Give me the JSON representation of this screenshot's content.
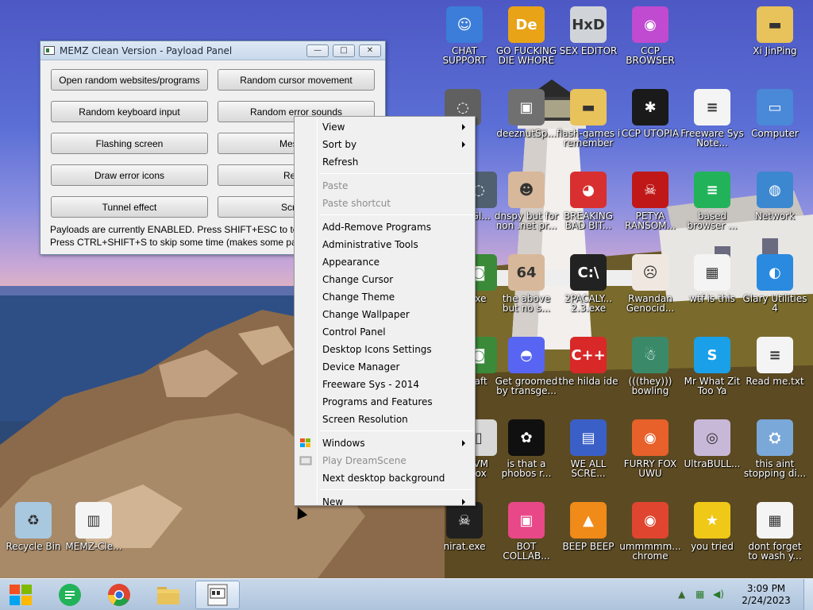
{
  "window": {
    "title": "MEMZ Clean Version - Payload Panel",
    "buttons": [
      "Open random websites/programs",
      "Random cursor movement",
      "Random keyboard input",
      "Random error sounds",
      "Flashing screen",
      "Messag",
      "Draw error icons",
      "Rever",
      "Tunnel effect",
      "Screen"
    ],
    "status_line1": "Payloads are currently ENABLED. Press SHIFT+ESC to toggle all",
    "status_line2": "Press CTRL+SHIFT+S to skip some time (makes some payloads f",
    "minimize_glyph": "—",
    "maximize_glyph": "□",
    "close_glyph": "✕"
  },
  "context_menu": {
    "items": [
      {
        "label": "View",
        "submenu": true,
        "disabled": false
      },
      {
        "label": "Sort by",
        "submenu": true,
        "disabled": false
      },
      {
        "label": "Refresh",
        "submenu": false,
        "disabled": false
      },
      {
        "label": "Paste",
        "submenu": false,
        "disabled": true
      },
      {
        "label": "Paste shortcut",
        "submenu": false,
        "disabled": true
      },
      {
        "label": "Add-Remove Programs",
        "submenu": false,
        "disabled": false
      },
      {
        "label": "Administrative Tools",
        "submenu": false,
        "disabled": false
      },
      {
        "label": "Appearance",
        "submenu": false,
        "disabled": false
      },
      {
        "label": "Change Cursor",
        "submenu": false,
        "disabled": false
      },
      {
        "label": "Change Theme",
        "submenu": false,
        "disabled": false
      },
      {
        "label": "Change Wallpaper",
        "submenu": false,
        "disabled": false
      },
      {
        "label": "Control Panel",
        "submenu": false,
        "disabled": false
      },
      {
        "label": "Desktop Icons Settings",
        "submenu": false,
        "disabled": false
      },
      {
        "label": "Device Manager",
        "submenu": false,
        "disabled": false
      },
      {
        "label": "Freeware Sys - 2014",
        "submenu": false,
        "disabled": false
      },
      {
        "label": "Programs and Features",
        "submenu": false,
        "disabled": false
      },
      {
        "label": "Screen Resolution",
        "submenu": false,
        "disabled": false
      },
      {
        "label": "Windows",
        "submenu": true,
        "disabled": false
      },
      {
        "label": "Play DreamScene",
        "submenu": false,
        "disabled": true
      },
      {
        "label": "Next desktop background",
        "submenu": false,
        "disabled": false
      },
      {
        "label": "New",
        "submenu": true,
        "disabled": false
      }
    ]
  },
  "desktop_icons": [
    {
      "label": "CHAT SUPPORT",
      "icon": "support-person-icon",
      "color": "#3b7dd8",
      "glyph": "☺"
    },
    {
      "label": "GO FUCKING DIE WHORE",
      "icon": "de-app-icon",
      "color": "#e8a317",
      "glyph": "De"
    },
    {
      "label": "SEX EDITOR",
      "icon": "hxd-editor-icon",
      "color": "#d0d4d8",
      "glyph": "HxD"
    },
    {
      "label": "CCP BROWSER",
      "icon": "firefox-color-icon",
      "color": "#c04ad0",
      "glyph": "◉"
    },
    {
      "label": "Xi JinPing",
      "icon": "user-folder-icon",
      "color": "#e8c25a",
      "glyph": "▬"
    },
    {
      "label": "deeznutSp...",
      "icon": "stacked-windows-icon",
      "color": "#707070",
      "glyph": "▣"
    },
    {
      "label": "flash-games i remember",
      "icon": "folder-icon",
      "color": "#e8c25a",
      "glyph": "▬"
    },
    {
      "label": "CCP UTOPIA",
      "icon": "red-spider-icon",
      "color": "#1a1a1a",
      "glyph": "✱"
    },
    {
      "label": "Freeware Sys Note...",
      "icon": "document-icon",
      "color": "#f4f4f4",
      "glyph": "≡"
    },
    {
      "label": "Computer",
      "icon": "computer-icon",
      "color": "#4a88d8",
      "glyph": "▭"
    },
    {
      "label": "dnspy but for non .net pr...",
      "icon": "portrait-icon",
      "color": "#d8b89a",
      "glyph": "☻"
    },
    {
      "label": "BREAKING BAD BIT...",
      "icon": "angry-bird-icon",
      "color": "#d83030",
      "glyph": "◕"
    },
    {
      "label": "PETYA RANSOM...",
      "icon": "skull-icon",
      "color": "#c01818",
      "glyph": "☠"
    },
    {
      "label": "based browser ...",
      "icon": "green-chat-icon",
      "color": "#22b35a",
      "glyph": "≡"
    },
    {
      "label": "Network",
      "icon": "network-icon",
      "color": "#3c88d0",
      "glyph": "◍"
    },
    {
      "label": "the above but no s...",
      "icon": "portrait-64-icon",
      "color": "#d8b89a",
      "glyph": "64"
    },
    {
      "label": "2PACALY... 2.3.exe",
      "icon": "console-icon",
      "color": "#222222",
      "glyph": "C:\\"
    },
    {
      "label": "Rwandan Genocid...",
      "icon": "meme-face-icon",
      "color": "#f0e8e0",
      "glyph": "☹"
    },
    {
      "label": "wtf is this",
      "icon": "app-window-icon",
      "color": "#f4f4f4",
      "glyph": "▦"
    },
    {
      "label": "Glary Utilities 4",
      "icon": "glary-icon",
      "color": "#2a8ae0",
      "glyph": "◐"
    },
    {
      "label": "Get groomed by transge...",
      "icon": "discord-icon",
      "color": "#5865f2",
      "glyph": "◓"
    },
    {
      "label": "the hilda ide",
      "icon": "devcpp-icon",
      "color": "#d82828",
      "glyph": "C++"
    },
    {
      "label": "(((they))) bowling",
      "icon": "santa-icon",
      "color": "#3a8a6a",
      "glyph": "☃"
    },
    {
      "label": "Mr What Zit Too Ya",
      "icon": "skype-icon",
      "color": "#1aa0e8",
      "glyph": "S"
    },
    {
      "label": "Read me.txt",
      "icon": "text-file-icon",
      "color": "#f4f4f4",
      "glyph": "≡"
    },
    {
      "label": "is that a phobos r...",
      "icon": "icq-flower-icon",
      "color": "#101010",
      "glyph": "✿"
    },
    {
      "label": "WE ALL SCRE...",
      "icon": "pc-monitor-icon",
      "color": "#3a60c8",
      "glyph": "▤"
    },
    {
      "label": "FURRY FOX UWU",
      "icon": "firefox-icon",
      "color": "#e8602a",
      "glyph": "◉"
    },
    {
      "label": "UltraBULL...",
      "icon": "disc-icon",
      "color": "#c8b8d8",
      "glyph": "◎"
    },
    {
      "label": "this aint stopping di...",
      "icon": "installer-icon",
      "color": "#7aa8d8",
      "glyph": "⛭"
    },
    {
      "label": "Recycle Bin",
      "icon": "recycle-bin-icon",
      "color": "#a8c8e0",
      "glyph": "♻"
    },
    {
      "label": "MEMZ-Cle...",
      "icon": "memz-window-icon",
      "color": "#f4f4f4",
      "glyph": "▥"
    },
    {
      "label": "nirat.exe",
      "icon": "skull-exe-icon",
      "color": "#202020",
      "glyph": "☠"
    },
    {
      "label": "BOT COLLAB...",
      "icon": "pink-monitor-icon",
      "color": "#e84888",
      "glyph": "▣"
    },
    {
      "label": "BEEP BEEP",
      "icon": "vlc-cone-icon",
      "color": "#f08a18",
      "glyph": "▲"
    },
    {
      "label": "ummmmm... chrome",
      "icon": "chrome-icon",
      "color": "#e0452f",
      "glyph": "◉"
    },
    {
      "label": "you tried",
      "icon": "gold-star-icon",
      "color": "#f0c818",
      "glyph": "★"
    },
    {
      "label": "dont forget to wash y...",
      "icon": "app-window-icon",
      "color": "#f4f4f4",
      "glyph": "▦"
    },
    {
      "label": "...aft",
      "icon": "partial-icon",
      "color": "#3a8a3a",
      "glyph": "◙"
    },
    {
      "label": ".exe",
      "icon": "partial-exe-icon",
      "color": "#3a8a3a",
      "glyph": "◙"
    },
    {
      "label": "...VM ...ox",
      "icon": "partial-vm-icon",
      "color": "#d8d8d8",
      "glyph": "▯"
    },
    {
      "label": "...ew",
      "icon": "partial-steam-icon",
      "color": "#606060",
      "glyph": "◌"
    },
    {
      "label": "...Gl...",
      "icon": "partial-gl-icon",
      "color": "#506070",
      "glyph": "◌"
    }
  ],
  "taskbar": {
    "time": "3:09 PM",
    "date": "2/24/2023",
    "start_label": "Start",
    "show_hidden_glyph": "▲",
    "network_glyph": "▦",
    "volume_glyph": "◀)"
  },
  "colors": {
    "taskbar": "#b8cce2",
    "menu_bg": "#f0f0f0",
    "window_bg": "#f0f0f0"
  }
}
